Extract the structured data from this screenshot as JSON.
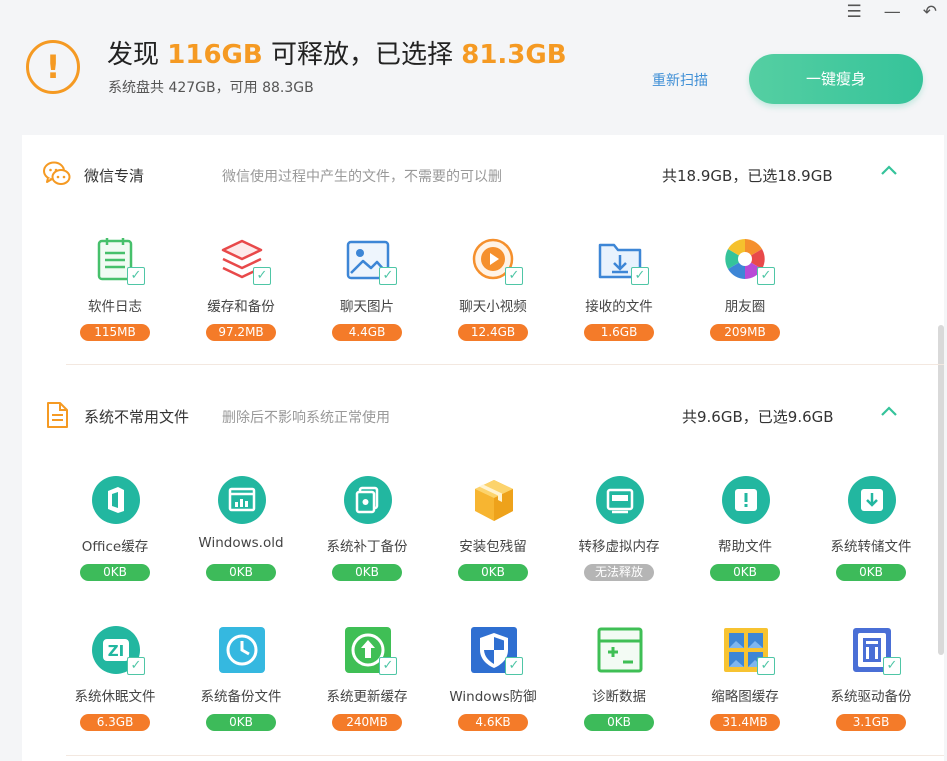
{
  "window": {
    "menu_icon": "☰",
    "minimize_icon": "—",
    "back_icon": "↶"
  },
  "header": {
    "warning_glyph": "!",
    "title_prefix": "发现 ",
    "found_size": "116GB",
    "title_middle": " 可释放，已选择 ",
    "selected_size": "81.3GB",
    "subtitle": "系统盘共 427GB，可用 88.3GB",
    "rescan_label": "重新扫描",
    "slim_button_label": "一键瘦身"
  },
  "sections": [
    {
      "title": "微信专清",
      "description": "微信使用过程中产生的文件，不需要的可以删",
      "total": "共18.9GB，已选18.9GB",
      "items": [
        {
          "label": "软件日志",
          "size": "115MB",
          "icon": "log-icon",
          "checked": true,
          "pill": "orange"
        },
        {
          "label": "缓存和备份",
          "size": "97.2MB",
          "icon": "stack-icon",
          "checked": true,
          "pill": "orange"
        },
        {
          "label": "聊天图片",
          "size": "4.4GB",
          "icon": "picture-icon",
          "checked": true,
          "pill": "orange"
        },
        {
          "label": "聊天小视频",
          "size": "12.4GB",
          "icon": "play-icon",
          "checked": true,
          "pill": "orange"
        },
        {
          "label": "接收的文件",
          "size": "1.6GB",
          "icon": "download-folder-icon",
          "checked": true,
          "pill": "orange"
        },
        {
          "label": "朋友圈",
          "size": "209MB",
          "icon": "aperture-icon",
          "checked": true,
          "pill": "orange"
        }
      ]
    },
    {
      "title": "系统不常用文件",
      "description": "删除后不影响系统正常使用",
      "total": "共9.6GB，已选9.6GB",
      "items": [
        {
          "label": "Office缓存",
          "size": "0KB",
          "icon": "office-icon",
          "checked": false,
          "pill": "green"
        },
        {
          "label": "Windows.old",
          "size": "0KB",
          "icon": "windows-old-icon",
          "checked": false,
          "pill": "green"
        },
        {
          "label": "系统补丁备份",
          "size": "0KB",
          "icon": "patch-icon",
          "checked": false,
          "pill": "green"
        },
        {
          "label": "安装包残留",
          "size": "0KB",
          "icon": "package-icon",
          "checked": false,
          "pill": "green"
        },
        {
          "label": "转移虚拟内存",
          "size": "无法释放",
          "icon": "memory-icon",
          "checked": false,
          "pill": "gray"
        },
        {
          "label": "帮助文件",
          "size": "0KB",
          "icon": "help-file-icon",
          "checked": false,
          "pill": "green"
        },
        {
          "label": "系统转储文件",
          "size": "0KB",
          "icon": "dump-icon",
          "checked": false,
          "pill": "green"
        },
        {
          "label": "系统休眠文件",
          "size": "6.3GB",
          "icon": "hibernate-icon",
          "checked": true,
          "pill": "orange"
        },
        {
          "label": "系统备份文件",
          "size": "0KB",
          "icon": "clock-icon",
          "checked": false,
          "pill": "green"
        },
        {
          "label": "系统更新缓存",
          "size": "240MB",
          "icon": "update-icon",
          "checked": true,
          "pill": "orange"
        },
        {
          "label": "Windows防御",
          "size": "4.6KB",
          "icon": "shield-icon",
          "checked": true,
          "pill": "orange"
        },
        {
          "label": "诊断数据",
          "size": "0KB",
          "icon": "diagnostics-icon",
          "checked": false,
          "pill": "green"
        },
        {
          "label": "缩略图缓存",
          "size": "31.4MB",
          "icon": "thumbnail-icon",
          "checked": true,
          "pill": "orange"
        },
        {
          "label": "系统驱动备份",
          "size": "3.1GB",
          "icon": "driver-icon",
          "checked": true,
          "pill": "orange"
        }
      ]
    }
  ],
  "colors": {
    "accent_orange": "#f59a23",
    "accent_green": "#35c39a",
    "pill_orange": "#f47b29",
    "pill_green": "#3dbb5a",
    "pill_gray": "#b5b5b5",
    "link_blue": "#3f8fd6"
  }
}
